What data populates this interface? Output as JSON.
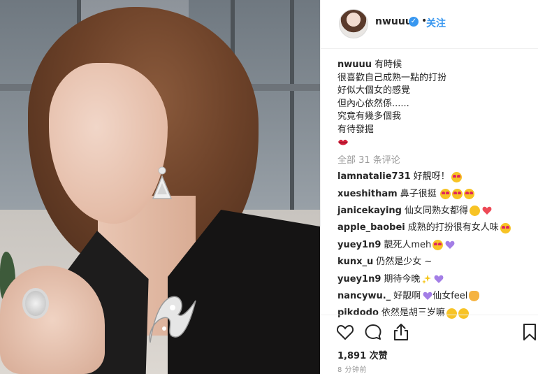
{
  "post": {
    "image_alt": "nwuuu 的照片",
    "author": {
      "username": "nwuuu",
      "verified": true,
      "separator": "•",
      "follow_label": "关注"
    },
    "caption": {
      "username": "nwuuu",
      "lines": [
        "有時候",
        "很喜歡自己成熟一點的打扮",
        "好似大個女的感覺",
        "但內心依然係......",
        "究竟有幾多個我",
        "有待發掘"
      ],
      "emoji": "kiss-lips"
    },
    "view_all_comments": "全部 31 条评论",
    "comments": [
      {
        "user": "lamnatalie731",
        "text": "好靚呀！",
        "emoji": [
          "heart-eyes"
        ]
      },
      {
        "user": "xueshitham",
        "text": "鼻子很挺",
        "emoji": [
          "heart-eyes",
          "heart-eyes",
          "heart-eyes"
        ]
      },
      {
        "user": "janicekaying",
        "text": "仙女同熟女都得",
        "emoji": [
          "smile",
          "red-heart"
        ]
      },
      {
        "user": "apple_baobei",
        "text": "成熟的打扮很有女人味",
        "emoji": [
          "heart-eyes"
        ]
      },
      {
        "user": "yuey1n9",
        "text": "靚死人meh",
        "emoji": [
          "heart-eyes",
          "purple-heart"
        ]
      },
      {
        "user": "kunx_u",
        "text": "仍然是少女 ~",
        "emoji": []
      },
      {
        "user": "yuey1n9",
        "text": "期待今晚",
        "emoji": [
          "sparkles",
          "purple-heart"
        ]
      },
      {
        "user": "nancywu._",
        "text": "好靓啊",
        "text2": "仙女feel",
        "emoji": [
          "purple-heart"
        ],
        "emoji2": [
          "cat-heart-eyes"
        ]
      },
      {
        "user": "pikdodo",
        "text": "依然是胡三岁嘛",
        "emoji": [
          "laughing",
          "laughing"
        ]
      }
    ],
    "likes": "1,891 次赞",
    "timestamp": "8 分钟前",
    "icons": {
      "like": "heart-outline-icon",
      "comment": "comment-bubble-icon",
      "share": "share-icon",
      "save": "bookmark-icon",
      "verified": "verified-badge-icon"
    },
    "colors": {
      "link": "#3897f0",
      "text": "#262626",
      "muted": "#999999",
      "red_heart": "#ed4956",
      "purple_heart": "#a37ee6"
    }
  }
}
